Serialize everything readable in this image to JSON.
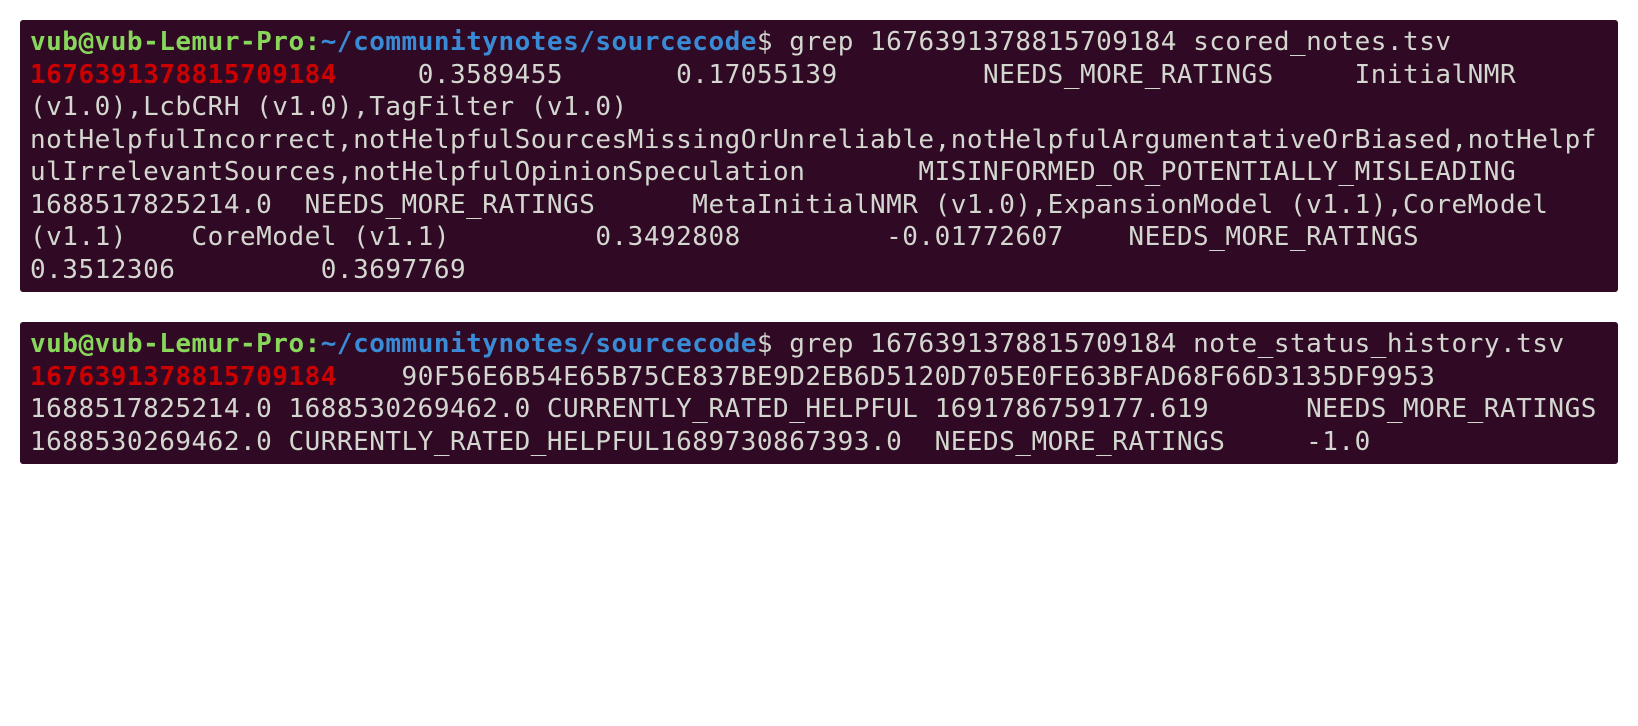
{
  "terminal1": {
    "prompt_user": "vub@vub-Lemur-Pro",
    "prompt_colon": ":",
    "prompt_tilde": "~",
    "prompt_path": "/communitynotes/sourcecode",
    "prompt_dollar": "$ ",
    "command": "grep 1676391378815709184 scored_notes.tsv",
    "match_id": "1676391378815709184",
    "output_rest": "     0.3589455       0.17055139         NEEDS_MORE_RATINGS     InitialNMR (v1.0),LcbCRH (v1.0),TagFilter (v1.0) notHelpfulIncorrect,notHelpfulSourcesMissingOrUnreliable,notHelpfulArgumentativeOrBiased,notHelpfulIrrelevantSources,notHelpfulOpinionSpeculation       MISINFORMED_OR_POTENTIALLY_MISLEADING  1688517825214.0  NEEDS_MORE_RATINGS      MetaInitialNMR (v1.0),ExpansionModel (v1.1),CoreModel (v1.1)    CoreModel (v1.1)         0.3492808         -0.01772607    NEEDS_MORE_RATINGS                           0.3512306         0.3697769"
  },
  "terminal2": {
    "prompt_user": "vub@vub-Lemur-Pro",
    "prompt_colon": ":",
    "prompt_tilde": "~",
    "prompt_path": "/communitynotes/sourcecode",
    "prompt_dollar": "$ ",
    "command": "grep 1676391378815709184 note_status_history.tsv",
    "match_id": "1676391378815709184",
    "output_rest": "    90F56E6B54E65B75CE837BE9D2EB6D5120D705E0FE63BFAD68F66D3135DF9953       1688517825214.0 1688530269462.0 CURRENTLY_RATED_HELPFUL 1691786759177.619      NEEDS_MORE_RATINGS       1688530269462.0 CURRENTLY_RATED_HELPFUL1689730867393.0  NEEDS_MORE_RATINGS     -1.0"
  }
}
